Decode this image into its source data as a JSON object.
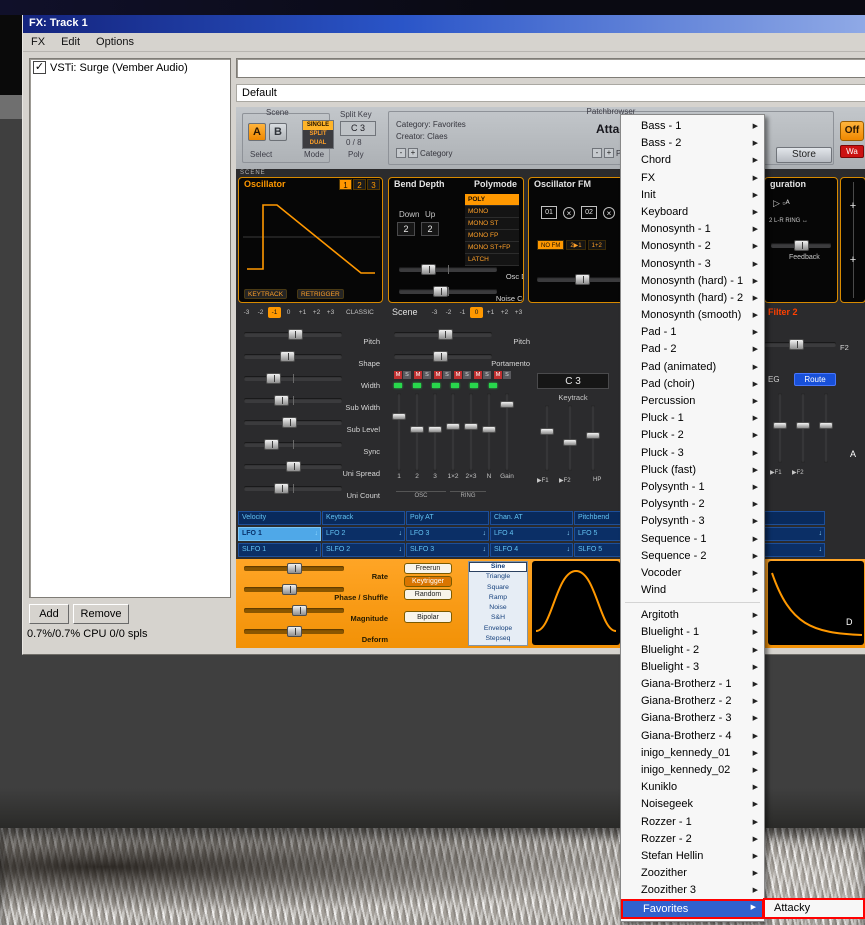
{
  "window": {
    "title": "FX: Track 1",
    "menu": [
      {
        "label": "FX"
      },
      {
        "label": "Edit"
      },
      {
        "label": "Options"
      }
    ],
    "plugins": {
      "item": "VSTi: Surge (Vember Audio)",
      "add": "Add",
      "remove": "Remove",
      "status": "0.7%/0.7% CPU 0/0 spls",
      "preset": "Default"
    }
  },
  "surge": {
    "topbar": {
      "scene_group": "Scene",
      "a": "A",
      "b": "B",
      "select": "Select",
      "modes": [
        {
          "label": "SINGLE",
          "selected": true
        },
        {
          "label": "SPLIT"
        },
        {
          "label": "DUAL"
        }
      ],
      "mode_label": "Mode",
      "split_key": "Split Key",
      "key": "C 3",
      "poly_count": "0 / 8",
      "poly": "Poly",
      "patchbrowser": "Patchbrowser",
      "category": "Category: Favorites",
      "creator": "Creator: Claes",
      "patch_name": "Attac",
      "minus": "-",
      "plus": "+",
      "category_btn": "Category",
      "patch_btn": "Patch",
      "store": "Store",
      "fx_off": "Off",
      "fx_red": "Wa"
    },
    "scene_tag": "SCENE",
    "oscillator": {
      "title": "Oscillator",
      "tabs": [
        {
          "label": "1",
          "selected": true
        },
        {
          "label": "2"
        },
        {
          "label": "3"
        }
      ],
      "keytrack": "KEYTRACK",
      "retrigger": "RETRIGGER"
    },
    "bend": {
      "title": "Bend Depth",
      "polymode_title": "Polymode",
      "down": "Down",
      "up": "Up",
      "down_value": "2",
      "up_value": "2",
      "modes": [
        {
          "label": "POLY",
          "selected": true
        },
        {
          "label": "MONO"
        },
        {
          "label": "MONO ST"
        },
        {
          "label": "MONO FP"
        },
        {
          "label": "MONO ST+FP"
        },
        {
          "label": "LATCH"
        }
      ],
      "sliders": [
        {
          "label": "Osc Drift",
          "pos": 30
        },
        {
          "label": "Noise Color",
          "pos": 42
        }
      ]
    },
    "oscfm": {
      "title": "Oscillator FM",
      "op1": "01",
      "op2": "02",
      "routing": [
        {
          "label": "NO FM",
          "selected": true
        },
        {
          "label": "2▶1"
        },
        {
          "label": "1+2"
        }
      ]
    },
    "fxpanel": {
      "title": "guration",
      "icons": "▷ ▫ᴬ",
      "lr_ring": "2 L-R RING ↔",
      "feedback": "Feedback",
      "plus1": "+",
      "plus2": "+"
    },
    "octave_row": {
      "left": [
        {
          "label": "-3"
        },
        {
          "label": "-2"
        },
        {
          "label": "-1",
          "selected": true
        },
        {
          "label": "0"
        },
        {
          "label": "+1"
        },
        {
          "label": "+2"
        },
        {
          "label": "+3"
        }
      ],
      "classic": "CLASSIC",
      "scene_label": "Scene",
      "right": [
        {
          "label": "-3"
        },
        {
          "label": "-2"
        },
        {
          "label": "-1"
        },
        {
          "label": "0",
          "selected": true
        },
        {
          "label": "+1"
        },
        {
          "label": "+2"
        },
        {
          "label": "+3"
        }
      ],
      "filter2": "Filter 2"
    },
    "left_sliders": [
      {
        "label": "Pitch",
        "pos": 52
      },
      {
        "label": "Shape",
        "pos": 44
      },
      {
        "label": "Width",
        "pos": 30
      },
      {
        "label": "Sub Width",
        "pos": 38
      },
      {
        "label": "Sub Level",
        "pos": 46
      },
      {
        "label": "Sync",
        "pos": 28
      },
      {
        "label": "Uni Spread",
        "pos": 50
      },
      {
        "label": "Uni Count",
        "pos": 38
      }
    ],
    "scene_sliders": [
      {
        "label": "Pitch",
        "pos": 52
      },
      {
        "label": "Portamento",
        "pos": 47
      }
    ],
    "f2_label": "F2",
    "mixer": {
      "strips": [
        {
          "m": "M",
          "s": "S"
        },
        {
          "m": "M",
          "s": "S"
        },
        {
          "m": "M",
          "s": "S"
        },
        {
          "m": "M",
          "s": "S"
        },
        {
          "m": "M",
          "s": "S"
        },
        {
          "m": "M",
          "s": "S"
        }
      ],
      "sliders": [
        {
          "label": "1",
          "pos": 30
        },
        {
          "label": "2",
          "pos": 46
        },
        {
          "label": "3",
          "pos": 46
        },
        {
          "label": "1×2",
          "pos": 42
        },
        {
          "label": "2×3",
          "pos": 42
        },
        {
          "label": "N",
          "pos": 46
        },
        {
          "label": "Gain",
          "pos": 14
        }
      ],
      "group_osc": "OSC",
      "group_ring": "RING"
    },
    "keytrack": {
      "note": "C 3",
      "label": "Keytrack",
      "sliders": [
        {
          "pos": 40
        },
        {
          "pos": 56
        },
        {
          "pos": 46
        }
      ],
      "f1": "▶F1",
      "f2": "▶F2",
      "hp": "HP"
    },
    "eg": {
      "label": "EG",
      "route": "Route",
      "sliders": [
        {
          "pos": 46
        },
        {
          "pos": 46
        },
        {
          "pos": 46
        }
      ],
      "f1": "▶F1",
      "f2": "▶F2",
      "a": "A"
    },
    "routing": {
      "row1": [
        {
          "label": "Velocity"
        },
        {
          "label": "Keytrack"
        },
        {
          "label": "Poly AT"
        },
        {
          "label": "Chan. AT"
        },
        {
          "label": "Pitchbend"
        },
        {
          "label": ""
        },
        {
          "label": ""
        }
      ],
      "row2": [
        {
          "label": "LFO 1",
          "arrow": "↓",
          "selected": true
        },
        {
          "label": "LFO 2",
          "arrow": "↓"
        },
        {
          "label": "LFO 3",
          "arrow": "↓"
        },
        {
          "label": "LFO 4",
          "arrow": "↓"
        },
        {
          "label": "LFO 5",
          "arrow": "↓"
        },
        {
          "label": "",
          "arrow": "↓"
        },
        {
          "label": "",
          "arrow": "↓"
        }
      ],
      "row3": [
        {
          "label": "SLFO 1",
          "arrow": "↓"
        },
        {
          "label": "SLFO 2",
          "arrow": "↓"
        },
        {
          "label": "SLFO 3",
          "arrow": "↓"
        },
        {
          "label": "SLFO 4",
          "arrow": "↓"
        },
        {
          "label": "SLFO 5",
          "arrow": "↓"
        },
        {
          "label": "",
          "arrow": "↓"
        },
        {
          "label": "",
          "arrow": "↓"
        }
      ]
    },
    "lfo": {
      "sliders": [
        {
          "label": "Rate",
          "pos": 50
        },
        {
          "label": "Phase / Shuffle",
          "pos": 45
        },
        {
          "label": "Magnitude",
          "pos": 55
        },
        {
          "label": "Deform",
          "pos": 50
        }
      ],
      "triggers": [
        {
          "label": "Freerun"
        },
        {
          "label": "Keytrigger",
          "selected": true
        },
        {
          "label": "Random"
        }
      ],
      "bipolar": "Bipolar",
      "shapes": [
        {
          "label": "Sine",
          "selected": true
        },
        {
          "label": "Triangle"
        },
        {
          "label": "Square"
        },
        {
          "label": "Ramp"
        },
        {
          "label": "Noise"
        },
        {
          "label": "S&H"
        },
        {
          "label": "Envelope"
        },
        {
          "label": "Stepseq"
        }
      ],
      "d_label": "D"
    }
  },
  "context_menu": {
    "items": [
      {
        "label": "Bass - 1"
      },
      {
        "label": "Bass - 2"
      },
      {
        "label": "Chord"
      },
      {
        "label": "FX"
      },
      {
        "label": "Init"
      },
      {
        "label": "Keyboard"
      },
      {
        "label": "Monosynth - 1"
      },
      {
        "label": "Monosynth - 2"
      },
      {
        "label": "Monosynth - 3"
      },
      {
        "label": "Monosynth (hard) - 1"
      },
      {
        "label": "Monosynth (hard) - 2"
      },
      {
        "label": "Monosynth (smooth)"
      },
      {
        "label": "Pad - 1"
      },
      {
        "label": "Pad - 2"
      },
      {
        "label": "Pad (animated)"
      },
      {
        "label": "Pad (choir)"
      },
      {
        "label": "Percussion"
      },
      {
        "label": "Pluck - 1"
      },
      {
        "label": "Pluck - 2"
      },
      {
        "label": "Pluck - 3"
      },
      {
        "label": "Pluck (fast)"
      },
      {
        "label": "Polysynth - 1"
      },
      {
        "label": "Polysynth - 2"
      },
      {
        "label": "Polysynth - 3"
      },
      {
        "label": "Sequence - 1"
      },
      {
        "label": "Sequence - 2"
      },
      {
        "label": "Vocoder"
      },
      {
        "label": "Wind"
      },
      {
        "separator": true
      },
      {
        "label": "Argitoth"
      },
      {
        "label": "Bluelight - 1"
      },
      {
        "label": "Bluelight - 2"
      },
      {
        "label": "Bluelight - 3"
      },
      {
        "label": "Giana-Brotherz - 1"
      },
      {
        "label": "Giana-Brotherz - 2"
      },
      {
        "label": "Giana-Brotherz - 3"
      },
      {
        "label": "Giana-Brotherz - 4"
      },
      {
        "label": "inigo_kennedy_01"
      },
      {
        "label": "inigo_kennedy_02"
      },
      {
        "label": "Kuniklo"
      },
      {
        "label": "Noisegeek"
      },
      {
        "label": "Rozzer - 1"
      },
      {
        "label": "Rozzer - 2"
      },
      {
        "label": "Stefan Hellin"
      },
      {
        "label": "Zoozither"
      },
      {
        "label": "Zoozither 3"
      }
    ],
    "favorites": {
      "label": "Favorites"
    },
    "submenu": {
      "label": "Attacky"
    }
  },
  "colors": {
    "annotation": "#ff0000",
    "surge_orange": "#ff9800",
    "routing_blue": "#0b2f66"
  }
}
